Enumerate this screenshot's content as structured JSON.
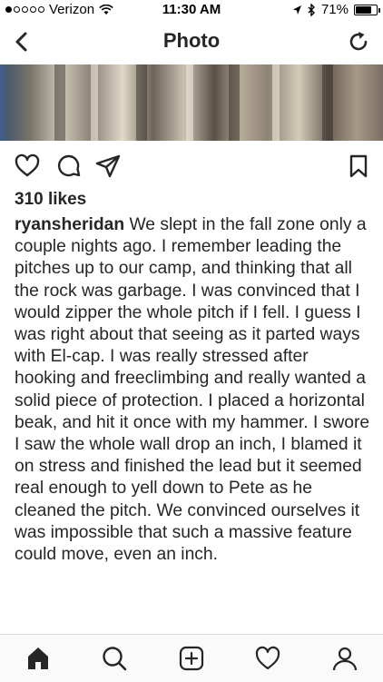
{
  "status_bar": {
    "carrier": "Verizon",
    "time": "11:30 AM",
    "battery": "71%",
    "battery_level": 0.71,
    "icons": [
      "signal-dots-icon",
      "wifi-icon",
      "location-arrow-icon",
      "bluetooth-icon",
      "battery-icon"
    ]
  },
  "nav": {
    "title": "Photo",
    "back_icon": "chevron-left-icon",
    "refresh_icon": "refresh-icon"
  },
  "actions": {
    "icons": [
      "heart-icon",
      "comment-icon",
      "share-icon",
      "bookmark-icon"
    ]
  },
  "post": {
    "likes": "310 likes",
    "username": "ryansheridan",
    "caption": "We slept in the fall zone only a couple nights ago. I remember leading the pitches up to our camp, and thinking that all the rock was garbage. I was convinced that I would zipper the whole pitch if I fell. I guess I was right about that seeing as it parted ways with El-cap. I was really stressed after hooking and freeclimbing and really wanted a solid piece of protection. I placed a horizontal beak, and hit it once with my hammer. I swore I saw the whole wall drop an inch, I blamed it on stress and finished the lead but it seemed real enough to yell down to Pete as he cleaned the pitch. We convinced ourselves it was impossible that such a massive feature could move, even an inch."
  },
  "tab_bar": {
    "icons": [
      "home-icon",
      "search-icon",
      "add-post-icon",
      "activity-heart-icon",
      "profile-icon"
    ]
  },
  "colors": {
    "text": "#262626",
    "divider": "#dbdbdb",
    "tab_background": "#fafafa"
  }
}
